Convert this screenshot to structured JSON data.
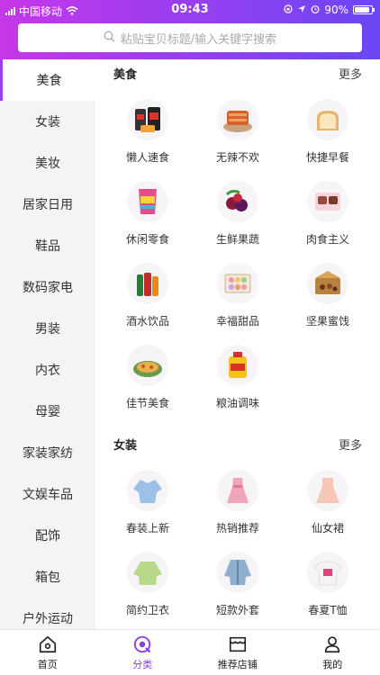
{
  "status": {
    "carrier": "中国移动",
    "time": "09:43",
    "battery": "90%",
    "battery_level": 0.9
  },
  "search": {
    "placeholder": "粘贴宝贝标题/输入关键字搜索"
  },
  "colors": {
    "accent": "#8a3df0",
    "header_start": "#c637e8",
    "header_end": "#6b46f3"
  },
  "sidebar": {
    "items": [
      {
        "label": "美食"
      },
      {
        "label": "女装"
      },
      {
        "label": "美妆"
      },
      {
        "label": "居家日用"
      },
      {
        "label": "鞋品"
      },
      {
        "label": "数码家电"
      },
      {
        "label": "男装"
      },
      {
        "label": "内衣"
      },
      {
        "label": "母婴"
      },
      {
        "label": "家装家纺"
      },
      {
        "label": "文娱车品"
      },
      {
        "label": "配饰"
      },
      {
        "label": "箱包"
      },
      {
        "label": "户外运动"
      }
    ]
  },
  "sections": [
    {
      "title": "美食",
      "more": "更多",
      "items": [
        {
          "label": "懒人速食",
          "icon": "instant-food-icon"
        },
        {
          "label": "无辣不欢",
          "icon": "spicy-snack-icon"
        },
        {
          "label": "快捷早餐",
          "icon": "bread-icon"
        },
        {
          "label": "休闲零食",
          "icon": "chips-icon"
        },
        {
          "label": "生鲜果蔬",
          "icon": "fruit-icon"
        },
        {
          "label": "肉食主义",
          "icon": "meat-icon"
        },
        {
          "label": "酒水饮品",
          "icon": "drinks-icon"
        },
        {
          "label": "幸福甜品",
          "icon": "macaron-icon"
        },
        {
          "label": "坚果蜜饯",
          "icon": "nuts-icon"
        },
        {
          "label": "佳节美食",
          "icon": "festive-food-icon"
        },
        {
          "label": "粮油调味",
          "icon": "oil-icon"
        }
      ]
    },
    {
      "title": "女装",
      "more": "更多",
      "items": [
        {
          "label": "春装上新",
          "icon": "blouse-icon"
        },
        {
          "label": "热销推荐",
          "icon": "pink-dress-icon"
        },
        {
          "label": "仙女裙",
          "icon": "fairy-dress-icon"
        },
        {
          "label": "简约卫衣",
          "icon": "sweatshirt-icon"
        },
        {
          "label": "短款外套",
          "icon": "denim-jacket-icon"
        },
        {
          "label": "春夏T恤",
          "icon": "tshirt-icon"
        }
      ]
    }
  ],
  "tabbar": {
    "items": [
      {
        "label": "首页"
      },
      {
        "label": "分类"
      },
      {
        "label": "推荐店铺"
      },
      {
        "label": "我的"
      }
    ]
  }
}
